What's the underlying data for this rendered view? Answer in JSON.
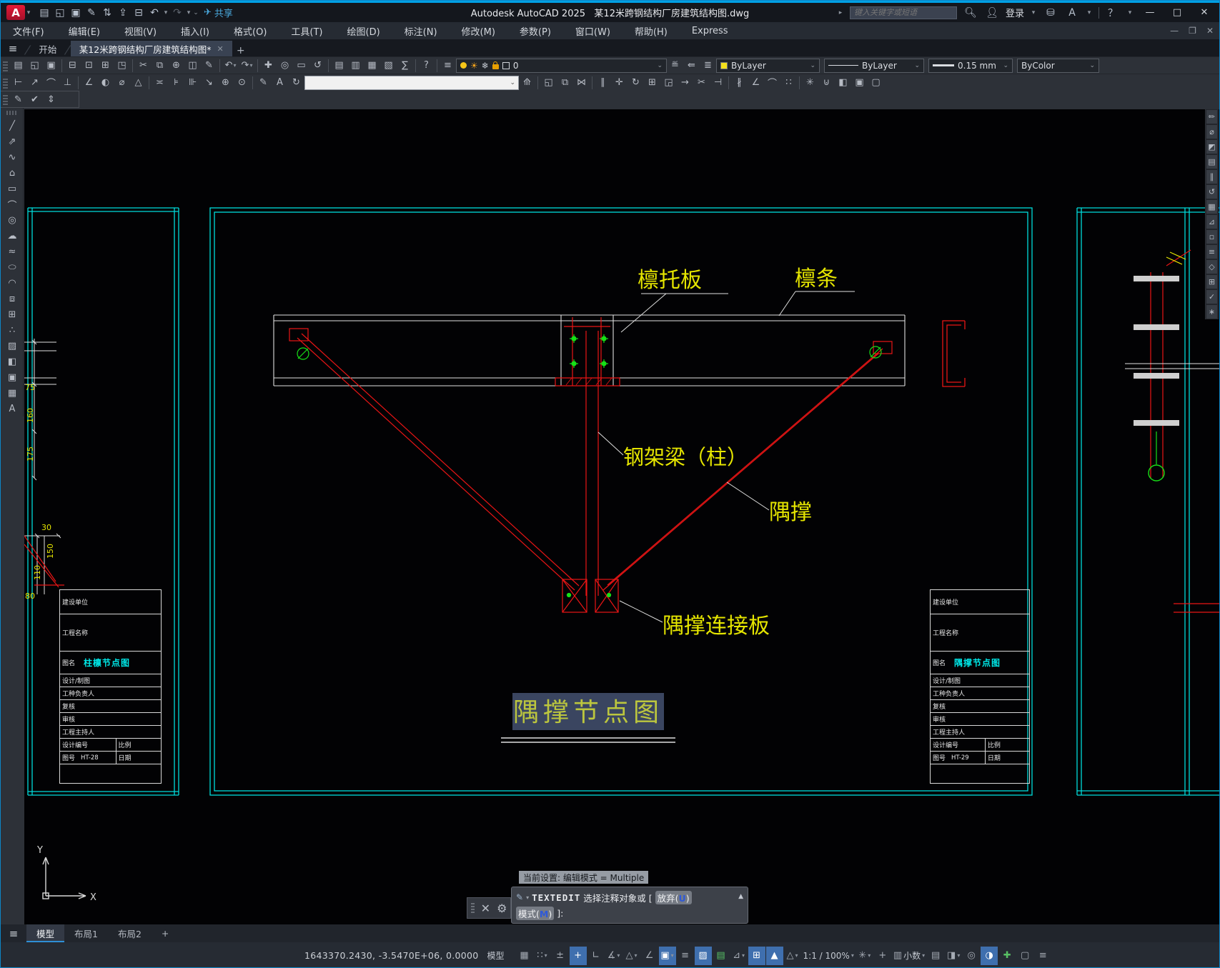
{
  "titlebar": {
    "app_name": "Autodesk AutoCAD 2025",
    "doc_name": "某12米跨钢结构厂房建筑结构图.dwg",
    "share_label": "共享",
    "search_placeholder": "键入关键字或短语",
    "signin_label": "登录",
    "qat_icons": [
      {
        "n": "new-file-icon",
        "g": "▤"
      },
      {
        "n": "open-file-icon",
        "g": "◱"
      },
      {
        "n": "save-icon",
        "g": "▣"
      },
      {
        "n": "save-as-icon",
        "g": "✎"
      },
      {
        "n": "open-from-web-icon",
        "g": "⇅"
      },
      {
        "n": "save-to-web-icon",
        "g": "⇪"
      },
      {
        "n": "plot-icon",
        "g": "⊟"
      },
      {
        "n": "undo-icon",
        "g": "↶"
      },
      {
        "n": "undo-caret",
        "g": "▾",
        "caret": 1
      },
      {
        "n": "redo-icon",
        "g": "↷",
        "dim": 1
      },
      {
        "n": "redo-caret",
        "g": "▾",
        "caret": 1
      },
      {
        "n": "qat-customize-caret",
        "g": "⌄",
        "caret": 1
      }
    ]
  },
  "menubar": {
    "items": [
      "文件(F)",
      "编辑(E)",
      "视图(V)",
      "插入(I)",
      "格式(O)",
      "工具(T)",
      "绘图(D)",
      "标注(N)",
      "修改(M)",
      "参数(P)",
      "窗口(W)",
      "帮助(H)",
      "Express"
    ]
  },
  "filetabs": {
    "start_tab": "开始",
    "doc_tab": "某12米跨钢结构厂房建筑结构图*",
    "close_glyph": "✕",
    "new_tab_glyph": "+"
  },
  "toolbar1": {
    "std_icons": [
      {
        "n": "new-icon",
        "g": "▤"
      },
      {
        "n": "open-icon",
        "g": "◱"
      },
      {
        "n": "save-icon",
        "g": "▣"
      },
      {
        "sep": 1
      },
      {
        "n": "print-icon",
        "g": "⊟"
      },
      {
        "n": "print-preview-icon",
        "g": "⊡"
      },
      {
        "n": "publish-icon",
        "g": "⊞"
      },
      {
        "n": "export-dwf-icon",
        "g": "◳"
      },
      {
        "sep": 1
      },
      {
        "n": "cut-icon",
        "g": "✂"
      },
      {
        "n": "copy-clip-icon",
        "g": "⧉"
      },
      {
        "n": "paste-icon",
        "g": "⊕"
      },
      {
        "n": "match-properties-icon",
        "g": "◫"
      },
      {
        "n": "edit-icon",
        "g": "✎"
      },
      {
        "sep": 1
      },
      {
        "n": "undo-icon",
        "g": "↶",
        "c": 1
      },
      {
        "n": "redo-icon",
        "g": "↷",
        "c": 1
      },
      {
        "sep": 1
      },
      {
        "n": "pan-icon",
        "g": "✚"
      },
      {
        "n": "zoom-realtime-icon",
        "g": "◎"
      },
      {
        "n": "zoom-window-icon",
        "g": "▭"
      },
      {
        "n": "zoom-previous-icon",
        "g": "↺"
      },
      {
        "sep": 1
      },
      {
        "n": "properties-palette-icon",
        "g": "▤"
      },
      {
        "n": "designcenter-icon",
        "g": "▥"
      },
      {
        "n": "tool-palettes-icon",
        "g": "▦"
      },
      {
        "n": "sheet-set-icon",
        "g": "▧"
      },
      {
        "n": "calculator-icon",
        "g": "∑"
      },
      {
        "sep": 1
      },
      {
        "n": "help-icon",
        "g": "?"
      }
    ],
    "layer_tools": [
      {
        "n": "make-object-layer-current-icon",
        "g": "≝"
      },
      {
        "n": "layer-previous-icon",
        "g": "⇚"
      },
      {
        "n": "layer-states-icon",
        "g": "≣"
      }
    ],
    "layer_value": "0",
    "color_value": "ByLayer",
    "linetype_value": "ByLayer",
    "lineweight_value": "0.15 mm",
    "plotstyle_value": "ByColor"
  },
  "toolbar2": {
    "dim_icons": [
      {
        "n": "dim-linear-icon",
        "g": "⊢"
      },
      {
        "n": "dim-aligned-icon",
        "g": "↗"
      },
      {
        "n": "dim-arc-icon",
        "g": "⌒"
      },
      {
        "n": "dim-ordinate-icon",
        "g": "⊥"
      },
      {
        "sep": 1
      },
      {
        "n": "dim-angular-icon",
        "g": "∠"
      },
      {
        "n": "dim-radius-icon",
        "g": "◐"
      },
      {
        "n": "dim-diameter-icon",
        "g": "⌀"
      },
      {
        "n": "dim-angle-icon",
        "g": "△"
      },
      {
        "sep": 1
      },
      {
        "n": "dim-quick-icon",
        "g": "≍"
      },
      {
        "n": "dim-baseline-icon",
        "g": "⊧"
      },
      {
        "n": "dim-continue-icon",
        "g": "⊪"
      },
      {
        "n": "dim-leader-icon",
        "g": "↘"
      },
      {
        "n": "dim-tolerance-icon",
        "g": "⊕"
      },
      {
        "n": "dim-center-mark-icon",
        "g": "⊙"
      },
      {
        "sep": 1
      },
      {
        "n": "dim-edit-icon",
        "g": "✎"
      },
      {
        "n": "dim-text-edit-icon",
        "g": "A"
      },
      {
        "n": "dim-update-icon",
        "g": "↻"
      }
    ],
    "modify_icons": [
      {
        "n": "erase-icon",
        "g": "◱"
      },
      {
        "n": "copy-icon",
        "g": "⧉"
      },
      {
        "n": "mirror-icon",
        "g": "⋈"
      },
      {
        "sep": 1
      },
      {
        "n": "offset-icon",
        "g": "∥"
      },
      {
        "n": "move-icon",
        "g": "✛"
      },
      {
        "n": "rotate-icon",
        "g": "↻"
      },
      {
        "n": "copy2-icon",
        "g": "⊞"
      },
      {
        "n": "scale-icon",
        "g": "◲"
      },
      {
        "n": "stretch-icon",
        "g": "→"
      },
      {
        "n": "trim-icon",
        "g": "✂"
      },
      {
        "n": "extend-icon",
        "g": "⊣"
      },
      {
        "sep": 1
      },
      {
        "n": "break-icon",
        "g": "∦"
      },
      {
        "n": "chamfer-icon",
        "g": "∠"
      },
      {
        "n": "fillet-icon",
        "g": "⌒"
      },
      {
        "n": "array-icon",
        "g": "∷"
      },
      {
        "sep": 1
      },
      {
        "n": "explode-icon",
        "g": "✳"
      },
      {
        "n": "join-icon",
        "g": "⊍"
      },
      {
        "n": "block-edit-icon",
        "g": "◧"
      },
      {
        "n": "group-icon",
        "g": "▣"
      },
      {
        "n": "ungroup-icon",
        "g": "▢"
      }
    ]
  },
  "toolbar3": {
    "icons": [
      {
        "n": "edit-text-icon",
        "g": "✎"
      },
      {
        "n": "spell-check-icon",
        "g": "✔"
      },
      {
        "n": "scale-text-icon",
        "g": "⇕"
      }
    ]
  },
  "draw_toolbar": {
    "icons": [
      {
        "n": "line-icon",
        "g": "╱"
      },
      {
        "n": "construction-line-icon",
        "g": "⇗"
      },
      {
        "n": "polyline-icon",
        "g": "∿"
      },
      {
        "n": "polygon-icon",
        "g": "⌂"
      },
      {
        "n": "rectangle-icon",
        "g": "▭"
      },
      {
        "n": "arc-icon",
        "g": "⌒"
      },
      {
        "n": "circle-icon",
        "g": "◎"
      },
      {
        "n": "revision-cloud-icon",
        "g": "☁"
      },
      {
        "n": "spline-icon",
        "g": "≈"
      },
      {
        "n": "ellipse-icon",
        "g": "⬭"
      },
      {
        "n": "ellipse-arc-icon",
        "g": "◠"
      },
      {
        "n": "insert-block-icon",
        "g": "⧈"
      },
      {
        "n": "make-block-icon",
        "g": "⊞"
      },
      {
        "n": "point-icon",
        "g": "∴"
      },
      {
        "n": "hatch-icon",
        "g": "▨"
      },
      {
        "n": "gradient-icon",
        "g": "◧"
      },
      {
        "n": "region-icon",
        "g": "▣"
      },
      {
        "n": "table-icon",
        "g": "▦"
      },
      {
        "n": "text-icon",
        "g": "A"
      }
    ]
  },
  "right_toolbar": {
    "icons": [
      {
        "n": "measure-icon",
        "g": "✏"
      },
      {
        "n": "diameter-icon",
        "g": "⌀"
      },
      {
        "n": "mask-icon",
        "g": "◩"
      },
      {
        "n": "list-icon",
        "g": "▤"
      },
      {
        "n": "parallel-icon",
        "g": "∥"
      },
      {
        "n": "revert-icon",
        "g": "↺"
      },
      {
        "n": "grid-icon",
        "g": "▦"
      },
      {
        "n": "triangle-icon",
        "g": "⊿"
      },
      {
        "n": "swatch-icon",
        "g": "▫"
      },
      {
        "n": "layers-icon",
        "g": "≡"
      },
      {
        "n": "diamond-icon",
        "g": "◇"
      },
      {
        "n": "block-icon",
        "g": "⊞"
      },
      {
        "n": "check-icon",
        "g": "✓"
      },
      {
        "n": "pin-icon",
        "g": "∗"
      }
    ]
  },
  "drawing": {
    "labels": {
      "purlin_plate": "檩托板",
      "purlin": "檩条",
      "frame_beam": "钢架梁（柱）",
      "knee_brace": "隅撑",
      "brace_plate": "隅撑连接板",
      "sheet_title": "隅撑节点图"
    },
    "dims": {
      "d75": "75",
      "d160": "160",
      "d175": "175",
      "d30": "30",
      "d150": "150",
      "d110": "110",
      "d80": "80"
    },
    "ucs": {
      "x": "X",
      "y": "Y"
    },
    "colors": {
      "line_red": "#ea1515",
      "line_cyan": "#00dcdc",
      "line_white": "#e0e0e0",
      "text_yellow": "#e5e500",
      "marker_green": "#17e017",
      "fig_cyan": "#00e8e8",
      "highlight_bg": "#3a4560",
      "highlight_text": "#bcc63e"
    }
  },
  "titleblocks": {
    "labels": [
      "建设单位",
      "工程名称",
      "图名",
      "设计/制图",
      "工种负责人",
      "复核",
      "审核",
      "工程主持人",
      "设计编号",
      "比例",
      "图号",
      "日期"
    ],
    "left": {
      "fig_name": "柱檩节点图",
      "fig_no": "HT-28"
    },
    "right": {
      "fig_name": "隅撑节点图",
      "fig_no": "HT-29"
    }
  },
  "cmdline": {
    "history": "当前设置: 编辑模式 = Multiple",
    "name": "TEXTEDIT",
    "t1": "选择注释对象或 [",
    "o1a": "放弃(",
    "o1k": "U",
    "o1b": ")",
    "o2a": "模式(",
    "o2k": "M",
    "o2b": ")",
    "t2": "]:"
  },
  "layouttabs": {
    "items": [
      "模型",
      "布局1",
      "布局2"
    ],
    "new_glyph": "+"
  },
  "statusbar": {
    "coords": "1643370.2430, -3.5470E+06, 0.0000",
    "model_label": "模型",
    "icons": [
      {
        "n": "grid-display-icon",
        "g": "▦"
      },
      {
        "n": "snap-mode-icon",
        "g": "∷",
        "c": 1
      },
      {
        "n": "infer-constraints-icon",
        "g": "±"
      },
      {
        "n": "dynamic-input-icon",
        "g": "+",
        "a": 1
      },
      {
        "n": "ortho-mode-icon",
        "g": "∟"
      },
      {
        "n": "polar-tracking-icon",
        "g": "∡",
        "c": 1
      },
      {
        "n": "isodraft-icon",
        "g": "△",
        "c": 1
      },
      {
        "n": "object-snap-tracking-icon",
        "g": "∠"
      },
      {
        "n": "object-snap-icon",
        "g": "▣",
        "a": 1,
        "c": 1
      },
      {
        "n": "lineweight-display-icon",
        "g": "≡"
      },
      {
        "n": "transparency-icon",
        "g": "▨",
        "a": 1
      },
      {
        "n": "selection-cycling-icon",
        "g": "▤",
        "green": 1
      },
      {
        "n": "3d-object-snap-icon",
        "g": "⊿",
        "c": 1
      },
      {
        "n": "dynamic-ucs-icon",
        "g": "⊞",
        "a": 1
      },
      {
        "n": "annotation-visibility-icon",
        "g": "▲",
        "a": 1
      },
      {
        "n": "autoscale-icon",
        "g": "△",
        "c": 1
      },
      {
        "n": "annotation-scale-icon",
        "label": "1:1 / 100%",
        "c": 1
      },
      {
        "n": "workspace-switching-icon",
        "g": "✳",
        "c": 1
      },
      {
        "n": "annotation-monitor-icon",
        "g": "+"
      },
      {
        "n": "units-icon",
        "g": "▥",
        "label": "小数",
        "c": 1
      },
      {
        "n": "quick-properties-icon",
        "g": "▤"
      },
      {
        "n": "lock-ui-icon",
        "g": "◨",
        "c": 1
      },
      {
        "n": "isolate-objects-icon",
        "g": "◎"
      },
      {
        "n": "graphics-performance-icon",
        "g": "◑",
        "a": 1
      },
      {
        "n": "trusted-autoloader-icon",
        "g": "✚",
        "green": 1
      },
      {
        "n": "clean-screen-icon",
        "g": "▢"
      },
      {
        "n": "customize-icon",
        "g": "≡"
      }
    ]
  }
}
